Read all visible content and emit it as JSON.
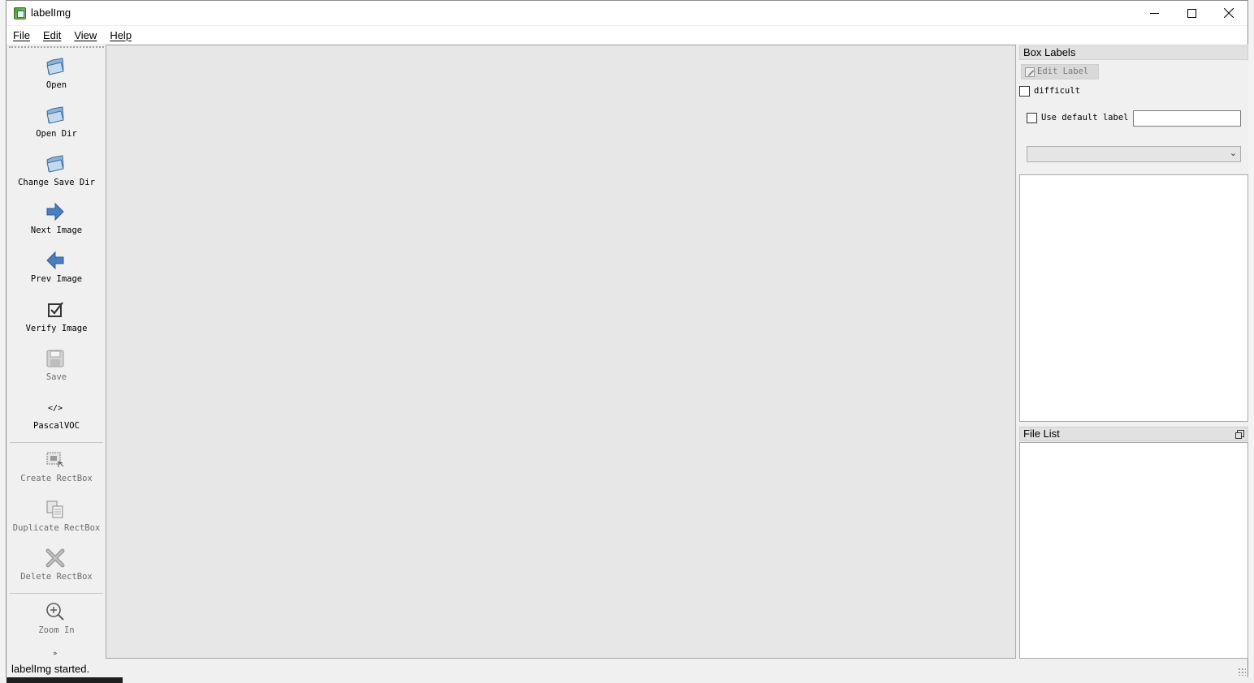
{
  "window": {
    "title": "labelImg",
    "controls": {
      "minimize": "minimize",
      "maximize": "maximize",
      "close": "close"
    }
  },
  "menu": [
    "File",
    "Edit",
    "View",
    "Help"
  ],
  "toolbar": {
    "items": [
      {
        "label": "Open",
        "icon": "folder-open-icon",
        "enabled": true
      },
      {
        "label": "Open Dir",
        "icon": "folder-open-icon",
        "enabled": true
      },
      {
        "label": "Change Save Dir",
        "icon": "folder-open-icon",
        "enabled": true
      },
      {
        "label": "Next Image",
        "icon": "arrow-right-icon",
        "enabled": true
      },
      {
        "label": "Prev Image",
        "icon": "arrow-left-icon",
        "enabled": true
      },
      {
        "label": "Verify Image",
        "icon": "checkbox-icon",
        "enabled": true
      },
      {
        "label": "Save",
        "icon": "save-icon",
        "enabled": false
      },
      {
        "label": "PascalVOC",
        "icon": "code-format-icon",
        "enabled": true
      },
      {
        "label": "Create RectBox",
        "icon": "create-rect-icon",
        "enabled": false
      },
      {
        "label": "Duplicate RectBox",
        "icon": "duplicate-icon",
        "enabled": false
      },
      {
        "label": "Delete RectBox",
        "icon": "delete-icon",
        "enabled": false
      },
      {
        "label": "Zoom In",
        "icon": "zoom-in-icon",
        "enabled": false
      }
    ],
    "overflow_glyph": "»"
  },
  "box_labels": {
    "title": "Box Labels",
    "edit_label_button": "Edit Label",
    "difficult_label": "difficult",
    "difficult_checked": false,
    "use_default_label": "Use default label",
    "use_default_checked": false,
    "default_label_value": "",
    "combo_value": ""
  },
  "file_list": {
    "title": "File List"
  },
  "status": {
    "text": "labelImg started."
  },
  "colors": {
    "arrow_blue": "#4a7fc1",
    "canvas_bg": "#e7e7e7",
    "dock_title_bg": "#e1e1e1"
  }
}
